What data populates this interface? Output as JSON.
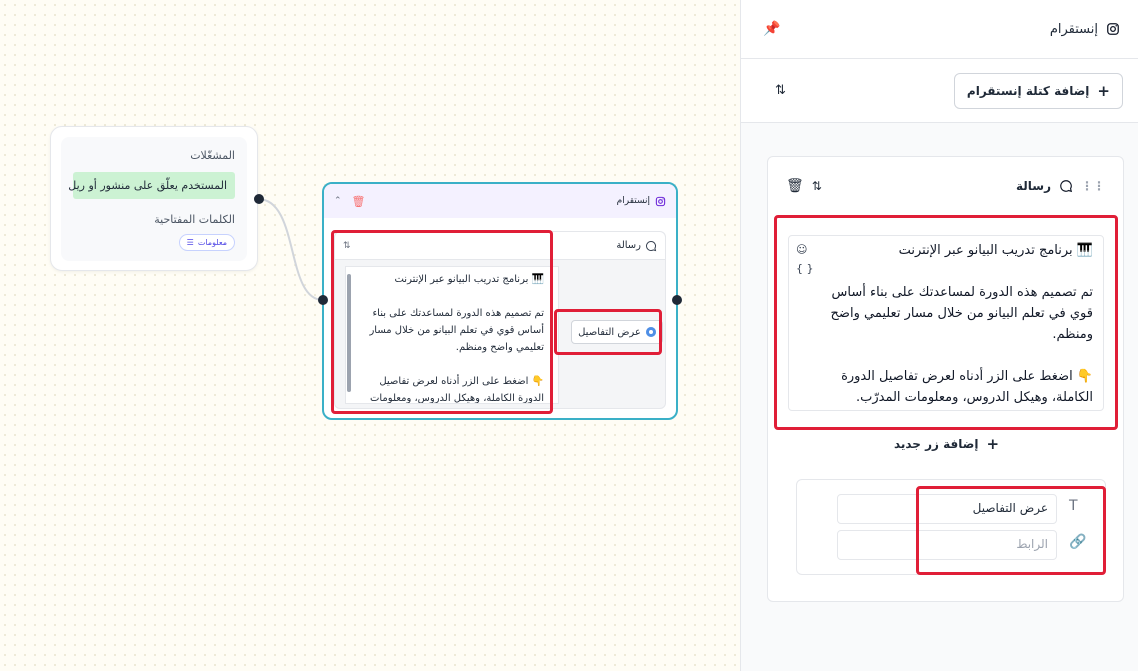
{
  "canvas": {
    "trigger": {
      "triggers_label": "المشغّلات",
      "trigger_value": "المستخدم يعلّق على منشور أو ريل",
      "keywords_label": "الكلمات المفتاحية",
      "keyword_chip": "معلومات"
    },
    "instagram_node": {
      "title": "إنستقرام",
      "message_label": "رسالة",
      "message_text": "🎹 برنامج تدريب البيانو عبر الإنترنت\n\nتم تصميم هذه الدورة لمساعدتك على بناء أساس قوي في تعلم البيانو من خلال مسار تعليمي واضح ومنظم.\n\n👇 اضغط على الزر أدناه لعرض تفاصيل الدورة الكاملة، وهيكل الدروس، ومعلومات",
      "button_label": "عرض التفاصيل"
    }
  },
  "panel": {
    "title": "إنستقرام",
    "add_block_label": "إضافة كتلة إنستقرام",
    "message_card": {
      "title": "رسالة",
      "text": "🎹 برنامج تدريب البيانو عبر الإنترنت\n\nتم تصميم هذه الدورة لمساعدتك على بناء أساس قوي في تعلم البيانو من خلال مسار تعليمي واضح ومنظم.\n\n👇 اضغط على الزر أدناه لعرض تفاصيل الدورة الكاملة، وهيكل الدروس، ومعلومات المدرّب.",
      "add_button_label": "إضافة زر جديد",
      "button_text_value": "عرض التفاصيل",
      "button_url_placeholder": "الرابط"
    }
  },
  "colors": {
    "highlight": "#e01e37",
    "node_border": "#3ab0c7",
    "trigger_pill": "#ccf2d3",
    "accent_blue": "#4f8fe6"
  }
}
